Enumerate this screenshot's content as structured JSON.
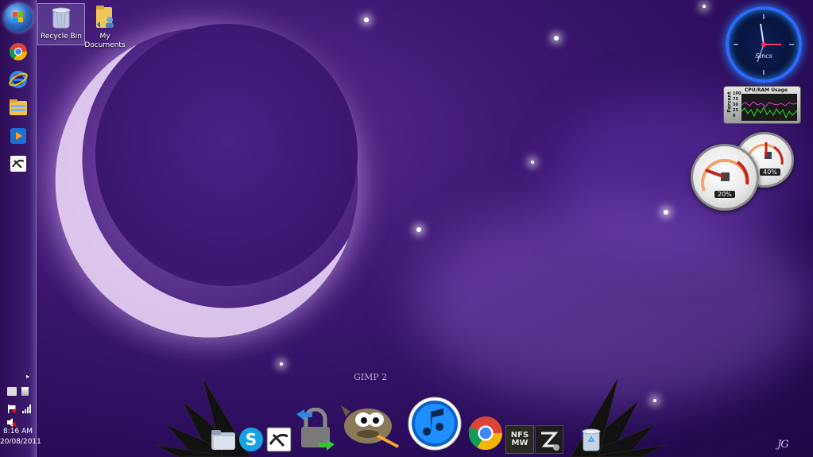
{
  "desktop": {
    "icons": [
      {
        "label": "Recycle Bin",
        "icon": "recycle-bin-icon"
      },
      {
        "label": "My\nDocuments",
        "icon": "folder-user-icon"
      }
    ]
  },
  "taskbar": {
    "pinned": [
      {
        "icon": "windows-start-icon"
      },
      {
        "icon": "chrome-icon"
      },
      {
        "icon": "internet-explorer-icon"
      },
      {
        "icon": "file-explorer-icon"
      },
      {
        "icon": "media-player-icon"
      },
      {
        "icon": "xfire-icon"
      }
    ],
    "tray": {
      "time": "8:16 AM",
      "date": "20/08/2011"
    }
  },
  "gadgets": {
    "clock": {
      "brand": "Sincs"
    },
    "cpu_meter": {
      "title": "CPU/RAM Usage",
      "axis_label": "Percent",
      "ticks": [
        "100",
        "75",
        "50",
        "25",
        "0"
      ]
    },
    "meters": [
      {
        "label": "20%",
        "value": 0.2
      },
      {
        "label": "40%",
        "value": 0.4
      }
    ]
  },
  "dock": {
    "hover_label": "GIMP 2",
    "items": [
      {
        "icon": "folder-icon"
      },
      {
        "icon": "skype-icon"
      },
      {
        "icon": "xfire-icon"
      },
      {
        "icon": "vpn-lock-icon"
      },
      {
        "icon": "gimp-icon"
      },
      {
        "icon": "itunes-icon"
      },
      {
        "icon": "chrome-icon"
      },
      {
        "icon": "nfs-mw-icon"
      },
      {
        "icon": "settings-app-icon"
      },
      {
        "icon": "recycle-bin-icon"
      }
    ],
    "nfs_text": "NFS\nMW"
  },
  "signature": "JG",
  "colors": {
    "accent": "#2a6bff",
    "taskbar": "#3c1b6e"
  }
}
